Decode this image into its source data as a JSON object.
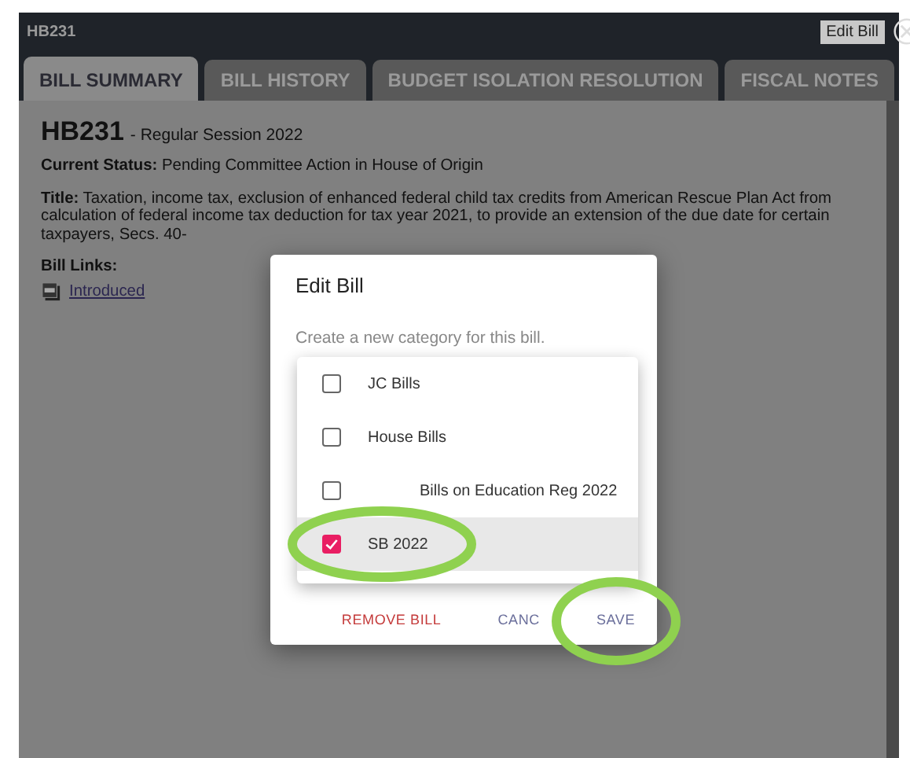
{
  "window": {
    "title": "HB231",
    "edit_button": "Edit Bill"
  },
  "tabs": [
    {
      "label": "BILL SUMMARY",
      "selected": true
    },
    {
      "label": "BILL HISTORY",
      "selected": false
    },
    {
      "label": "BUDGET ISOLATION RESOLUTION",
      "selected": false
    },
    {
      "label": "FISCAL NOTES",
      "selected": false
    }
  ],
  "bill": {
    "number": "HB231",
    "session": "- Regular Session 2022",
    "status_label": "Current Status:",
    "status": "Pending Committee Action in House of Origin",
    "title_label": "Title:",
    "title": "Taxation, income tax, exclusion of enhanced federal child tax credits from American Rescue Plan Act from calculation of federal income tax deduction for tax year 2021, to provide an extension of the due date for certain taxpayers, Secs. 40-",
    "links_label": "Bill Links:",
    "links": [
      {
        "label": "Introduced"
      }
    ]
  },
  "dialog": {
    "title": "Edit Bill",
    "hint": "Create a new category for this bill.",
    "options": [
      {
        "label": "JC Bills",
        "checked": false,
        "selected": false
      },
      {
        "label": "House Bills",
        "checked": false,
        "selected": false
      },
      {
        "label": "Bills on Education Reg 2022",
        "checked": false,
        "selected": false
      },
      {
        "label": "SB 2022",
        "checked": true,
        "selected": true
      }
    ],
    "buttons": [
      {
        "label": "REMOVE BILL",
        "kind": "danger"
      },
      {
        "label": "CANC",
        "kind": "plain"
      },
      {
        "label": "SAVE",
        "kind": "plain"
      }
    ]
  }
}
